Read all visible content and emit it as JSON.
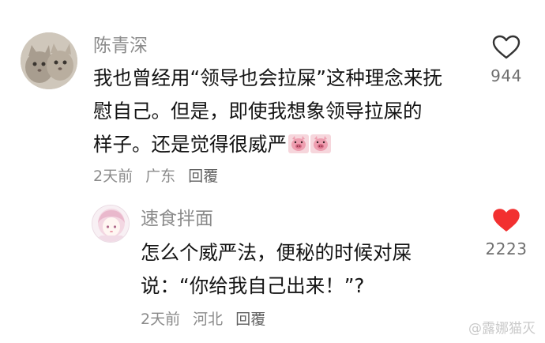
{
  "comments": [
    {
      "username": "陈青深",
      "lines": [
        "我也曾经用“领导也会拉屎”这种理念来抚",
        "慰自己。但是，即使我想象领导拉屎的",
        "样子。还是觉得很威严"
      ],
      "time": "2天前",
      "location": "广东",
      "reply_label": "回覆",
      "likes": "944",
      "liked": false
    },
    {
      "username": "速食拌面",
      "lines": [
        "怎么个威严法，便秘的时候对屎",
        "说：“你给我自己出来！”?"
      ],
      "time": "2天前",
      "location": "河北",
      "reply_label": "回覆",
      "likes": "2223",
      "liked": true
    }
  ],
  "icons": {
    "like": "heart-icon",
    "emoji": "pig-emoji-icon"
  },
  "colors": {
    "liked_heart": "#f23030",
    "unliked_heart": "#333333",
    "meta_text": "#8b8b8b"
  },
  "watermark": "@露娜猫灭"
}
